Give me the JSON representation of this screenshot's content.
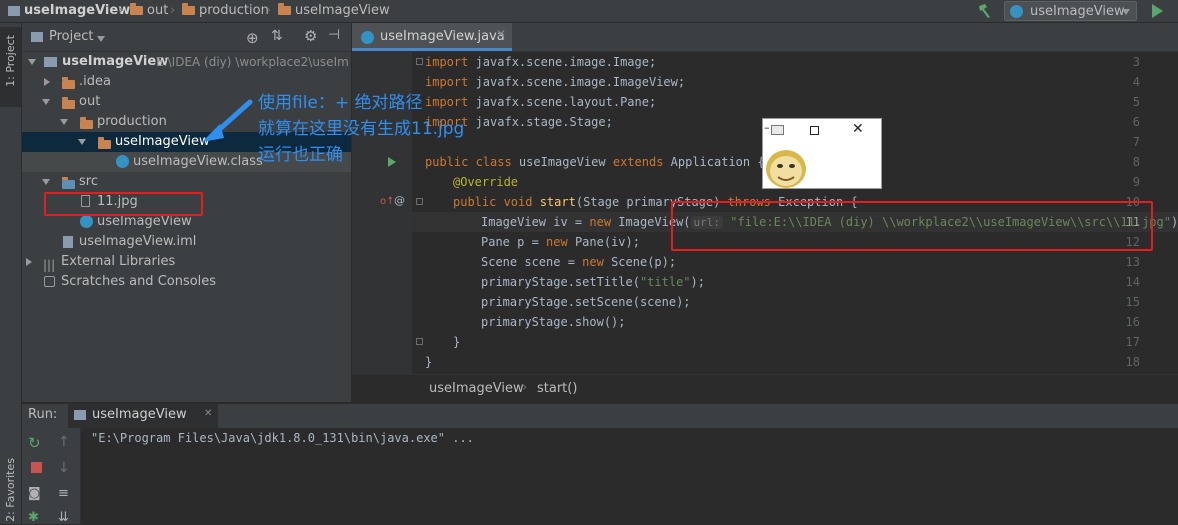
{
  "navbar": {
    "crumbs": [
      "useImageView",
      "out",
      "production",
      "useImageView"
    ],
    "run_config": "useImageView"
  },
  "left_stripe": {
    "project_tab": "1: Project",
    "favorites_tab": "2: Favorites"
  },
  "project": {
    "title": "Project",
    "tree": [
      {
        "label": "useImageView",
        "extra": "E:\\IDEA  (diy)  \\workplace2\\useIm"
      },
      {
        "label": ".idea"
      },
      {
        "label": "out"
      },
      {
        "label": "production"
      },
      {
        "label": "useImageView"
      },
      {
        "label": "useImageView.class"
      },
      {
        "label": "src"
      },
      {
        "label": "11.jpg"
      },
      {
        "label": "useImageView"
      },
      {
        "label": "useImageView.iml"
      },
      {
        "label": "External Libraries"
      },
      {
        "label": "Scratches and Consoles"
      }
    ]
  },
  "editor": {
    "tab": "useImageView.java",
    "line_numbers": [
      "3",
      "4",
      "5",
      "6",
      "7",
      "8",
      "9",
      "10",
      "11",
      "12",
      "13",
      "14",
      "15",
      "16",
      "17",
      "18"
    ],
    "code": {
      "l3": [
        "import",
        " javafx.scene.image.Image;"
      ],
      "l4": [
        "import",
        " javafx.scene.image.ImageView;"
      ],
      "l5": [
        "import",
        " javafx.scene.layout.Pane;"
      ],
      "l6": [
        "import",
        " javafx.stage.Stage;"
      ],
      "l8": [
        "public class",
        " useImageView ",
        "extends",
        " Application {"
      ],
      "l9": "@Override",
      "l10": [
        "public void",
        " start",
        "(Stage primaryStage) ",
        "throws",
        " Exception {"
      ],
      "l11": [
        "ImageView iv = ",
        "new",
        " ImageView(",
        "url:",
        "\"file:E:\\\\IDEA (diy) \\\\workplace2\\\\useImageView\\\\src\\\\11.jpg\"",
        ");"
      ],
      "l12": [
        "Pane p = ",
        "new",
        " Pane(iv);"
      ],
      "l13": [
        "Scene scene = ",
        "new",
        " Scene(p);"
      ],
      "l14": [
        "primaryStage.setTitle(",
        "\"title\"",
        ");"
      ],
      "l15": "primaryStage.setScene(scene);",
      "l16": "primaryStage.show();",
      "l17": "}",
      "l18": "}"
    },
    "breadcrumb": [
      "useImageView",
      "start()"
    ]
  },
  "annotation": {
    "line1": "使用file：+ 绝对路径",
    "line2": "就算在这里没有生成11.jpg",
    "line3": "运行也正确"
  },
  "run": {
    "label": "Run:",
    "tab": "useImageView",
    "output": "\"E:\\Program Files\\Java\\jdk1.8.0_131\\bin\\java.exe\" ..."
  },
  "colors": {
    "accent": "#4a88c7",
    "highlight_box": "#e02020",
    "annotation_text": "#2f8ff0"
  }
}
